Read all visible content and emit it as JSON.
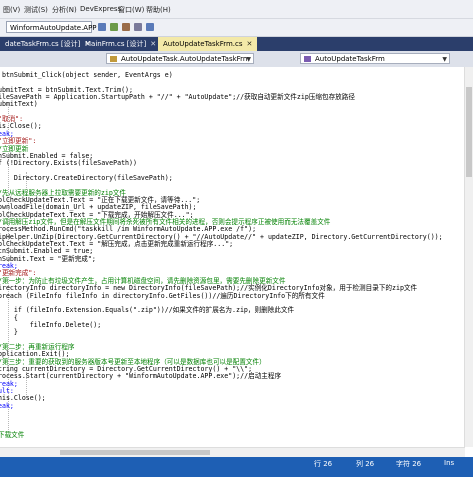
{
  "menu": {
    "items": [
      "图(V)",
      "测试(S)",
      "分析(N)",
      "DevExpress",
      "窗口(W)",
      "帮助(H)"
    ]
  },
  "toolbar": {
    "project_combo": "WinformAutoUpdate.APP"
  },
  "tabs": [
    {
      "label": "dateTaskFrm.cs [设计]"
    },
    {
      "label": "MainFrm.cs [设计]"
    },
    {
      "label": "AutoUpdateTaskFrm.cs"
    }
  ],
  "nav": {
    "class_box": "AutoUpdateTask.AutoUpdateTaskFrm",
    "member_box": "AutoUpdateTaskFrm"
  },
  "code": [
    {
      "t": " btnSubmit_Click(object sender, EventArgs e)",
      "c": ""
    },
    {
      "t": "",
      "c": ""
    },
    {
      "t": "ubmitText = btnSubmit.Text.Trim();",
      "c": ""
    },
    {
      "t": "ileSavePath = Application.StartupPath + \"//\" + \"AutoUpdate\";//获取自动更新文件zip压缩包存放路径",
      "c": ""
    },
    {
      "t": "ubmitText)",
      "c": ""
    },
    {
      "t": "",
      "c": ""
    },
    {
      "t": "\"取消\":",
      "c": "st"
    },
    {
      "t": "is.Close();",
      "c": ""
    },
    {
      "t": "eak;",
      "c": "kw"
    },
    {
      "t": "\"立即更新\":",
      "c": "st"
    },
    {
      "t": "/立即更新",
      "c": "cm"
    },
    {
      "t": "nSubmit.Enabled = false;",
      "c": ""
    },
    {
      "t": "f (!Directory.Exists(fileSavePath))",
      "c": ""
    },
    {
      "t": "",
      "c": ""
    },
    {
      "t": "    Directory.CreateDirectory(fileSavePath);",
      "c": ""
    },
    {
      "t": "",
      "c": ""
    },
    {
      "t": "/先从远程服务器上拉取需要更新的zip文件",
      "c": "cm"
    },
    {
      "t": "blCheckUpdateText.Text = \"正在下载更新文件，请等待...\";",
      "c": ""
    },
    {
      "t": "ownloadFile(domain_Url + updateZIP, fileSavePath);",
      "c": ""
    },
    {
      "t": "blCheckUpdateText.Text = \"下载完成，开始解压文件...\";",
      "c": ""
    },
    {
      "t": "/调用解压zip文件，但是在解压文件期间将杀死被所有文件相关的进程，否则会提示程序正被使用而无法覆盖文件",
      "c": "cm"
    },
    {
      "t": "rocessMethod.RunCmd(\"taskkill /im WinformAutoUpdate.APP.exe /f\");",
      "c": ""
    },
    {
      "t": "ipHelper.UnZip(Directory.GetCurrentDirectory() + \"//AutoUpdate//\" + updateZIP, Directory.GetCurrentDirectory());",
      "c": ""
    },
    {
      "t": "blCheckUpdateText.Text = \"解压完成，点击更新完成重新运行程序...\";",
      "c": ""
    },
    {
      "t": "tnSubmit.Enabled = true;",
      "c": ""
    },
    {
      "t": "nSubmit.Text = \"更新完成\";",
      "c": ""
    },
    {
      "t": "reak;",
      "c": "kw"
    },
    {
      "t": "\"更新完成\":",
      "c": "st"
    },
    {
      "t": "/第一步：为防止有垃圾文件产生，占用计算机磁盘空间，请先删除资源包里，需要先删除更新文件",
      "c": "cm"
    },
    {
      "t": "irectoryInfo directoryInfo = new DirectoryInfo(fileSavePath);//实例化DirectoryInfo对象，用于检测目录下的zip文件",
      "c": ""
    },
    {
      "t": "oreach (FileInfo fileInfo in directoryInfo.GetFiles())//遍历DirectoryInfo下的所有文件",
      "c": ""
    },
    {
      "t": "",
      "c": ""
    },
    {
      "t": "    if (fileInfo.Extension.Equals(\".zip\"))//如果文件的扩展名为.zip，则删除此文件",
      "c": ""
    },
    {
      "t": "    {",
      "c": ""
    },
    {
      "t": "        fileInfo.Delete();",
      "c": ""
    },
    {
      "t": "    }",
      "c": ""
    },
    {
      "t": "",
      "c": ""
    },
    {
      "t": "/第二步：再重新运行程序",
      "c": "cm"
    },
    {
      "t": "pplication.Exit();",
      "c": ""
    },
    {
      "t": "/第三步：重要的获取到的服务器版本号更新至本地程序（可以是数据库也可以是配置文件）",
      "c": "cm"
    },
    {
      "t": "tring currentDirectory = Directory.GetCurrentDirectory() + \"\\\\\";",
      "c": ""
    },
    {
      "t": "rocess.Start(currentDirectory + \"WinformAutoUpdate.APP.exe\");//启动主程序",
      "c": ""
    },
    {
      "t": "reak;",
      "c": "kw"
    },
    {
      "t": "ult:",
      "c": "kw"
    },
    {
      "t": "his.Close();",
      "c": ""
    },
    {
      "t": "eak;",
      "c": "kw"
    },
    {
      "t": "",
      "c": ""
    },
    {
      "t": "",
      "c": ""
    },
    {
      "t": "",
      "c": ""
    },
    {
      "t": "下载文件",
      "c": "cm"
    }
  ],
  "status": {
    "left": "",
    "line": "行 26",
    "col": "列 26",
    "ch": "字符 26",
    "mode": "Ins"
  }
}
